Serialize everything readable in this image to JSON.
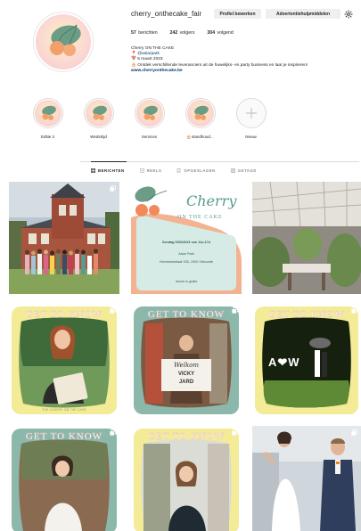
{
  "profile": {
    "username": "cherry_onthecake_fair",
    "edit_button": "Profiel bewerken",
    "ads_button": "Advertentiehulpmiddelen",
    "settings_icon": "gear-icon"
  },
  "stats": {
    "posts_count": "57",
    "posts_label": "berichten",
    "followers_count": "242",
    "followers_label": "volgers",
    "following_count": "304",
    "following_label": "volgend"
  },
  "bio": {
    "name": "Cherry ON THE CAKE",
    "line1": "📍 @asiarpark",
    "line2": "📅 5 maart 2023",
    "line3": "🎂 Ontdek verschillende leveranciers uit de huwelijks- en party business en laat je inspireren!",
    "website": "www.cherryonthecake.be"
  },
  "highlights": [
    {
      "label": "Editie 2"
    },
    {
      "label": "Wedstrijd"
    },
    {
      "label": "Services"
    },
    {
      "label": "🎂standhoud..."
    },
    {
      "label": "Nieuw"
    }
  ],
  "tabs": [
    {
      "label": "BERICHTEN",
      "icon": "grid-icon",
      "active": true
    },
    {
      "label": "REELS",
      "icon": "reels-icon",
      "active": false
    },
    {
      "label": "OPGESLAGEN",
      "icon": "bookmark-icon",
      "active": false
    },
    {
      "label": "GETAGD",
      "icon": "tag-icon",
      "active": false
    }
  ],
  "posts": {
    "invite": {
      "cherry": "Cherry",
      "on_the_cake": "ON THE CAKE",
      "date_line": "Zondag 5/03/2023 van 11u-17u",
      "venue": "Asiar Park",
      "address": "Hechelanstraat 155, 1900 Vilvoorde",
      "cta": "Inkom is gratis"
    },
    "gtk_title": "GET TO KNOW",
    "gtk_footer": "THE CHERRY ON THE CAKE",
    "welcome_sign": {
      "line1": "Welkom",
      "line2": "VICKY",
      "line3": "JARD"
    },
    "light_letters": "A❤W"
  },
  "colors": {
    "yellow": "#f3eb95",
    "teal": "#8cb8ab",
    "link": "#00376b",
    "peach": "#f4b896"
  }
}
